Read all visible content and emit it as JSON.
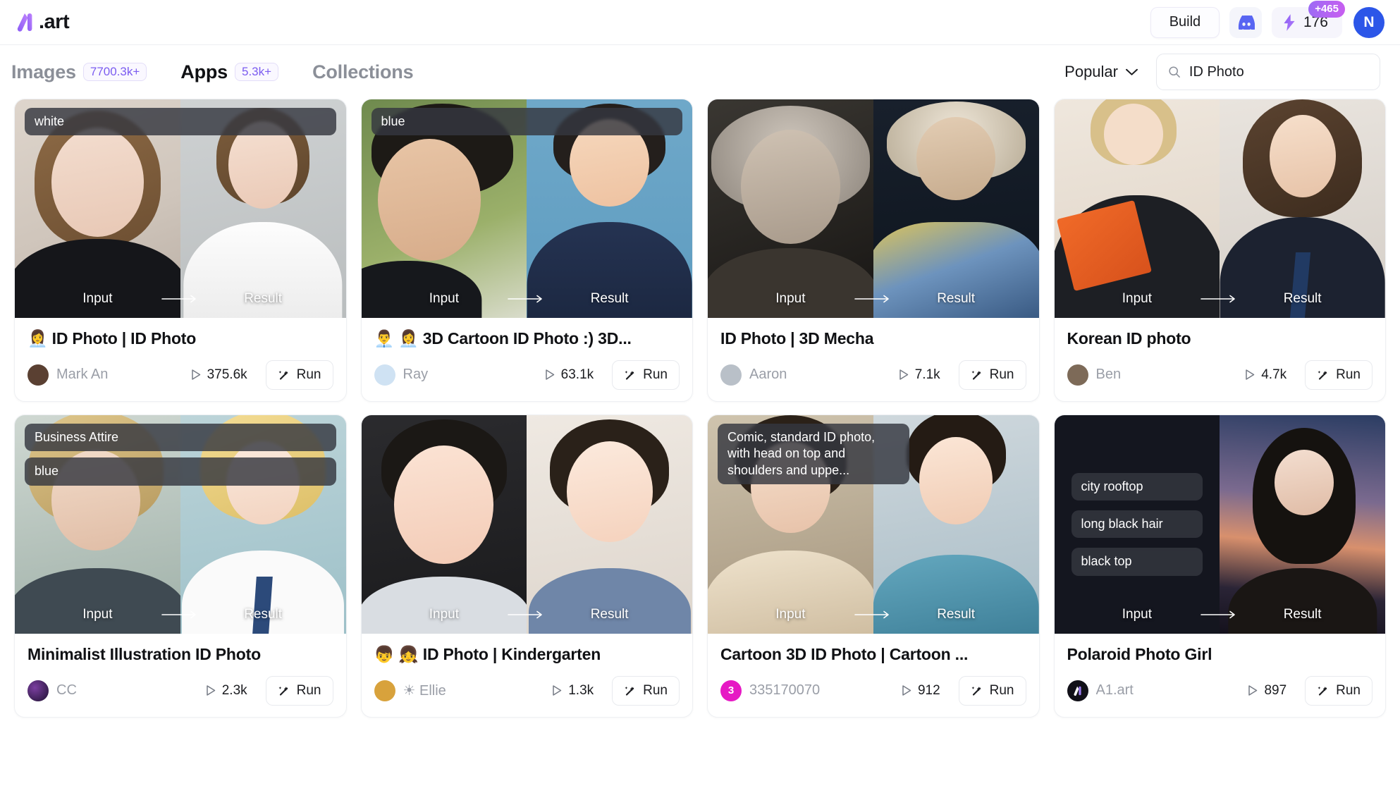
{
  "header": {
    "logo_text": ".art",
    "logo_icon": "a1-logo-icon",
    "build_label": "Build",
    "discord_icon": "discord-icon",
    "credits_icon": "lightning-bolt-icon",
    "credits_value": "176",
    "credits_badge": "+465",
    "avatar_initial": "N"
  },
  "tabs": [
    {
      "label": "Images",
      "count": "7700.3k+",
      "active": false
    },
    {
      "label": "Apps",
      "count": "5.3k+",
      "active": true
    },
    {
      "label": "Collections",
      "count": "",
      "active": false
    }
  ],
  "sort": {
    "label": "Popular",
    "icon": "chevron-down-icon"
  },
  "search": {
    "value": "ID Photo",
    "placeholder": "Search",
    "icon": "search-icon"
  },
  "labels": {
    "input": "Input",
    "result": "Result",
    "run": "Run",
    "run_icon": "magic-wand-icon",
    "runs_icon": "play-icon"
  },
  "cards": [
    {
      "title": "👩‍💼 ID Photo | ID Photo",
      "tags": [
        "white"
      ],
      "tag_style": "top",
      "author": "Mark An",
      "author_avatar_color": "#5a4032",
      "runs": "375.6k"
    },
    {
      "title": "👨‍💼 👩‍💼 3D Cartoon ID Photo :) 3D...",
      "tags": [
        "blue"
      ],
      "tag_style": "top",
      "author": "Ray",
      "author_avatar_color": "#cfe2f3",
      "runs": "63.1k"
    },
    {
      "title": "ID Photo | 3D Mecha",
      "tags": [],
      "tag_style": "top",
      "author": "Aaron",
      "author_avatar_color": "#b9c0c8",
      "runs": "7.1k"
    },
    {
      "title": "Korean ID photo",
      "tags": [],
      "tag_style": "top",
      "author": "Ben",
      "author_avatar_color": "#7d6a58",
      "runs": "4.7k"
    },
    {
      "title": "Minimalist Illustration ID Photo",
      "tags": [
        "Business Attire",
        "blue"
      ],
      "tag_style": "top",
      "author": "CC",
      "author_avatar_color": "#2a1f3d",
      "runs": "2.3k"
    },
    {
      "title": "👦 👧 ID Photo | Kindergarten",
      "tags": [],
      "tag_style": "top",
      "author": "☀ Ellie",
      "author_avatar_color": "#d8a23c",
      "runs": "1.3k"
    },
    {
      "title": "Cartoon 3D ID Photo | Cartoon ...",
      "tags": [
        "Comic, standard ID photo, with head on top and shoulders and uppe..."
      ],
      "tag_style": "top",
      "author": "335170070",
      "author_avatar_color": "#e619c4",
      "author_avatar_initial": "3",
      "runs": "912"
    },
    {
      "title": "Polaroid Photo Girl",
      "tags": [
        "city rooftop",
        "long black hair",
        "black top"
      ],
      "tag_style": "center",
      "author": "A1.art",
      "author_avatar_color": "#111018",
      "runs": "897"
    }
  ],
  "colors": {
    "accent_purple": "#7b5cf0",
    "badge_gradient_from": "#9b6bf5",
    "badge_gradient_to": "#c95ef0",
    "avatar_blue": "#2c56e8",
    "discord_blue": "#5865f2",
    "text_primary": "#101114",
    "text_muted": "#9a9ea7"
  }
}
